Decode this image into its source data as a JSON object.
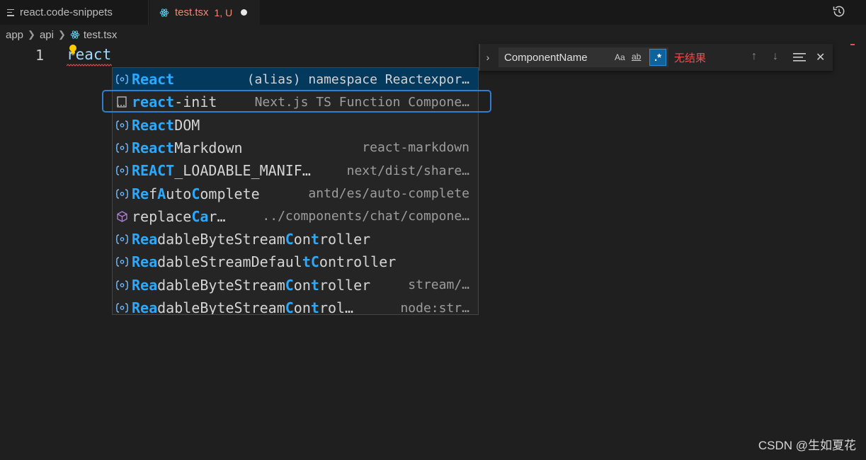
{
  "tabs": [
    {
      "label": "react.code-snippets",
      "icon": "lines-icon"
    },
    {
      "label": "test.tsx",
      "status": "1, U",
      "icon": "react-icon",
      "modified": true
    }
  ],
  "breadcrumb": [
    "app",
    "api",
    "test.tsx"
  ],
  "editor": {
    "line_number": "1",
    "text": "react"
  },
  "find": {
    "query": "ComponentName",
    "match_case": "Aa",
    "whole_word": "ab",
    "regex": ".*",
    "no_results": "无结果"
  },
  "suggestions": [
    {
      "icon": "namespace-icon",
      "parts": [
        {
          "t": "React",
          "m": true
        }
      ],
      "detail": "(alias) namespace Reactexpor…"
    },
    {
      "icon": "snippet-icon",
      "parts": [
        {
          "t": "react",
          "m": true
        },
        {
          "t": "-init",
          "m": false
        }
      ],
      "detail": "Next.js TS Function Compone…"
    },
    {
      "icon": "namespace-icon",
      "parts": [
        {
          "t": "React",
          "m": true
        },
        {
          "t": "DOM",
          "m": false
        }
      ],
      "detail": ""
    },
    {
      "icon": "namespace-icon",
      "parts": [
        {
          "t": "React",
          "m": true
        },
        {
          "t": "Markdown",
          "m": false
        }
      ],
      "detail": "react-markdown"
    },
    {
      "icon": "namespace-icon",
      "parts": [
        {
          "t": "REACT",
          "m": true
        },
        {
          "t": "_LOADABLE_MANIF…",
          "m": false
        }
      ],
      "detail": "next/dist/share…"
    },
    {
      "icon": "namespace-icon",
      "parts": [
        {
          "t": "Re",
          "m": true
        },
        {
          "t": "f",
          "m": false
        },
        {
          "t": "A",
          "m": true
        },
        {
          "t": "uto",
          "m": false
        },
        {
          "t": "C",
          "m": true
        },
        {
          "t": "omplete",
          "m": false
        }
      ],
      "detail": "antd/es/auto-complete"
    },
    {
      "icon": "method-icon",
      "parts": [
        {
          "t": "re",
          "m": false
        },
        {
          "t": "place",
          "m": false
        },
        {
          "t": "Ca",
          "m": true
        },
        {
          "t": "r…",
          "m": false
        }
      ],
      "detail": "../components/chat/compone…"
    },
    {
      "icon": "namespace-icon",
      "parts": [
        {
          "t": "Rea",
          "m": true
        },
        {
          "t": "dableByteStream",
          "m": false
        },
        {
          "t": "C",
          "m": true
        },
        {
          "t": "on",
          "m": false
        },
        {
          "t": "t",
          "m": true
        },
        {
          "t": "roller",
          "m": false
        }
      ],
      "detail": ""
    },
    {
      "icon": "namespace-icon",
      "parts": [
        {
          "t": "Rea",
          "m": true
        },
        {
          "t": "dableStreamDefaul",
          "m": false
        },
        {
          "t": "tC",
          "m": true
        },
        {
          "t": "ontroller",
          "m": false
        }
      ],
      "detail": ""
    },
    {
      "icon": "namespace-icon",
      "parts": [
        {
          "t": "Rea",
          "m": true
        },
        {
          "t": "dableByteStream",
          "m": false
        },
        {
          "t": "C",
          "m": true
        },
        {
          "t": "on",
          "m": false
        },
        {
          "t": "t",
          "m": true
        },
        {
          "t": "roller",
          "m": false
        }
      ],
      "detail": "stream/…"
    },
    {
      "icon": "namespace-icon",
      "parts": [
        {
          "t": "Rea",
          "m": true
        },
        {
          "t": "dableByteStream",
          "m": false
        },
        {
          "t": "C",
          "m": true
        },
        {
          "t": "on",
          "m": false
        },
        {
          "t": "t",
          "m": true
        },
        {
          "t": "rol…",
          "m": false
        }
      ],
      "detail": "node:str…"
    }
  ],
  "watermark": "CSDN @生如夏花"
}
